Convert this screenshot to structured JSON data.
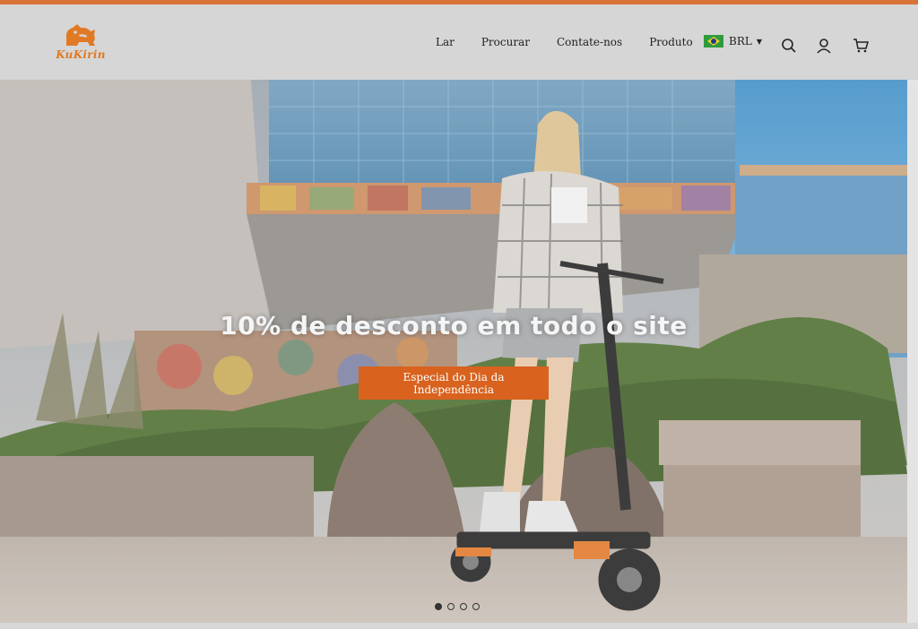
{
  "brand": {
    "logo_text": "KuKirin",
    "color": "#e07a25"
  },
  "nav": {
    "items": [
      "Lar",
      "Procurar",
      "Contate-nos",
      "Produto"
    ]
  },
  "currency": {
    "code": "BRL",
    "flag": "brazil-flag-icon"
  },
  "header_icons": [
    "search-icon",
    "account-icon",
    "cart-icon"
  ],
  "hero": {
    "headline": "10% de desconto em todo o site",
    "cta_label": "Especial do Dia da Independência",
    "cta_color": "#d8621e",
    "slides_total": 4,
    "active_slide": 1
  }
}
